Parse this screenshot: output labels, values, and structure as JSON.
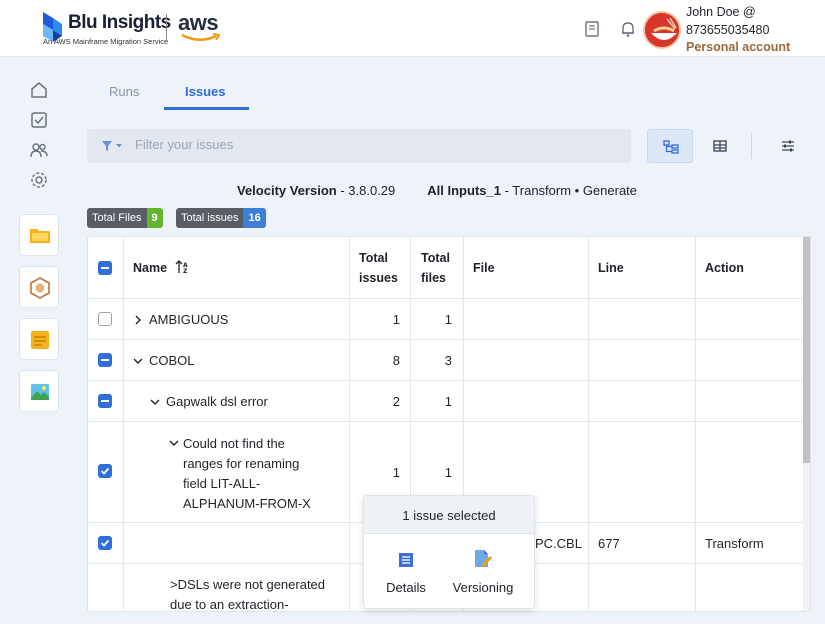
{
  "header": {
    "brand": "Blu Insights",
    "brand_subtitle": "An AWS Mainframe Migration Service",
    "partner": "aws",
    "user_name": "John Doe @",
    "account_id": "873655035480",
    "account_type": "Personal account"
  },
  "tabs": [
    {
      "label": "Runs",
      "active": false
    },
    {
      "label": "Issues",
      "active": true
    }
  ],
  "filter": {
    "placeholder": "Filter your issues"
  },
  "version": {
    "label": "Velocity Version",
    "separator": " - ",
    "value": "3.8.0.29",
    "inputs_label": "All Inputs_1",
    "inputs_separator": " - ",
    "inputs_value": "Transform • Generate"
  },
  "badges": {
    "files_label": "Total Files",
    "files_count": "9",
    "issues_label": "Total issues",
    "issues_count": "16"
  },
  "table": {
    "headers": {
      "name": "Name",
      "total_issues_1": "Total",
      "total_issues_2": "issues",
      "total_files_1": "Total",
      "total_files_2": "files",
      "file": "File",
      "line": "Line",
      "action": "Action"
    },
    "rows": [
      {
        "name": "AMBIGUOUS",
        "issues": "1",
        "files": "1",
        "state": "unchecked",
        "expanded": false
      },
      {
        "name": "COBOL",
        "issues": "8",
        "files": "3",
        "state": "partial",
        "expanded": true
      },
      {
        "name": "Gapwalk dsl error",
        "issues": "2",
        "files": "1",
        "state": "partial",
        "expanded": true
      },
      {
        "name_lines": [
          "Could not find the",
          "ranges for renaming",
          "field LIT-ALL-",
          "ALPHANUM-FROM-X"
        ],
        "issues": "1",
        "files": "1",
        "state": "checked",
        "expanded": true
      },
      {
        "file": "PC.CBL",
        "line": "677",
        "action": "Transform",
        "state": "checked"
      },
      {
        "name_lines": [
          ">DSLs were not generated",
          "due to an extraction-"
        ]
      }
    ]
  },
  "popup": {
    "title": "1 issue selected",
    "details_label": "Details",
    "versioning_label": "Versioning"
  },
  "colors": {
    "accent": "#2f6fd6",
    "files_badge": "#63b52e",
    "issues_badge": "#3b7fd8",
    "account_type": "#9a6a3a"
  },
  "icons": [
    "home-icon",
    "checklist-icon",
    "users-icon",
    "gear-icon",
    "folder-icon",
    "hexagon-icon",
    "notes-icon",
    "image-icon",
    "book-icon",
    "bell-icon",
    "filter-icon",
    "tree-view-icon",
    "table-view-icon",
    "settings-sliders-icon",
    "sort-icon",
    "chevron-right-icon",
    "chevron-down-icon",
    "details-icon",
    "versioning-icon"
  ]
}
